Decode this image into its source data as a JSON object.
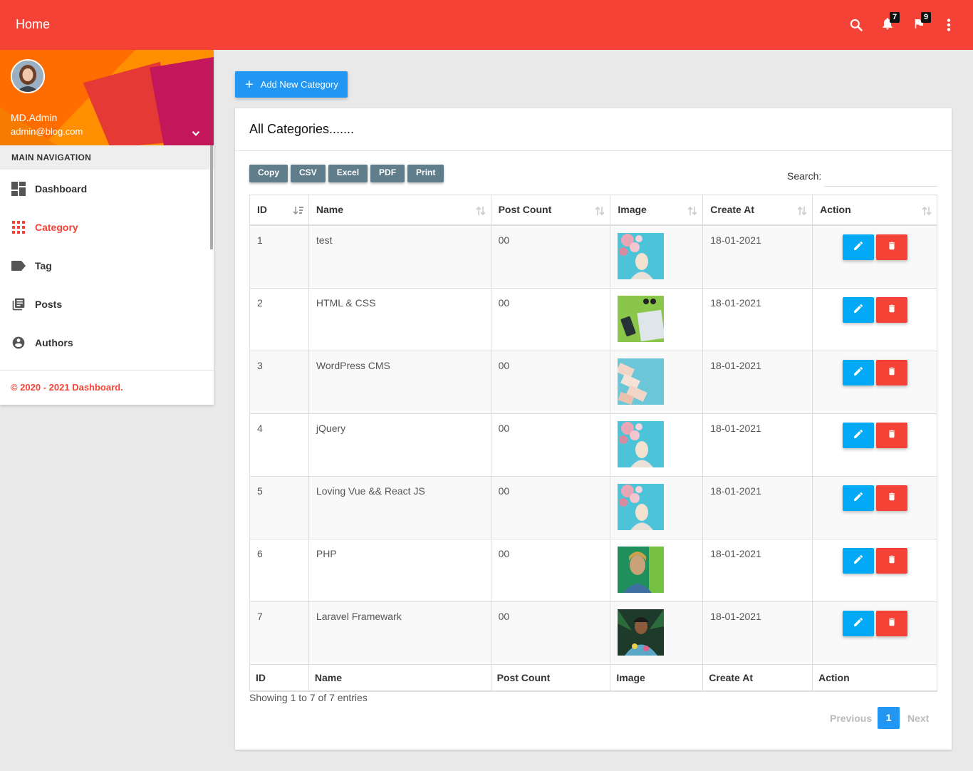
{
  "topbar": {
    "title": "Home",
    "notifications_count": "7",
    "tasks_count": "9",
    "icons": [
      "search-icon",
      "bell-icon",
      "flag-icon",
      "more-vert-icon"
    ],
    "bg_color": "#f44336"
  },
  "sidebar": {
    "user_name": "MD.Admin",
    "user_email": "admin@blog.com",
    "nav_header": "MAIN NAVIGATION",
    "items": [
      {
        "label": "Dashboard",
        "icon": "dashboard-icon",
        "active": false
      },
      {
        "label": "Category",
        "icon": "grid-icon",
        "active": true
      },
      {
        "label": "Tag",
        "icon": "tag-icon",
        "active": false
      },
      {
        "label": "Posts",
        "icon": "posts-icon",
        "active": false
      },
      {
        "label": "Authors",
        "icon": "account-icon",
        "active": false
      }
    ],
    "legal": "© 2020 - 2021 Dashboard."
  },
  "main": {
    "add_button_label": "Add New Category",
    "card_title": "All Categories.......",
    "export_buttons": [
      "Copy",
      "CSV",
      "Excel",
      "PDF",
      "Print"
    ],
    "search_label": "Search:",
    "search_value": "",
    "columns": [
      "ID",
      "Name",
      "Post Count",
      "Image",
      "Create At",
      "Action"
    ],
    "rows": [
      {
        "id": "1",
        "name": "test",
        "post_count": "00",
        "image": "woman-flowers-thumbnail",
        "created": "18-01-2021"
      },
      {
        "id": "2",
        "name": "HTML & CSS",
        "post_count": "00",
        "image": "desk-flatlay-thumbnail",
        "created": "18-01-2021"
      },
      {
        "id": "3",
        "name": "WordPress CMS",
        "post_count": "00",
        "image": "business-cards-thumbnail",
        "created": "18-01-2021"
      },
      {
        "id": "4",
        "name": "jQuery",
        "post_count": "00",
        "image": "woman-flowers-thumbnail",
        "created": "18-01-2021"
      },
      {
        "id": "5",
        "name": "Loving Vue && React JS",
        "post_count": "00",
        "image": "woman-flowers-thumbnail",
        "created": "18-01-2021"
      },
      {
        "id": "6",
        "name": "PHP",
        "post_count": "00",
        "image": "woman-portrait-green-thumbnail",
        "created": "18-01-2021"
      },
      {
        "id": "7",
        "name": "Laravel Framewark",
        "post_count": "00",
        "image": "woman-palm-thumbnail",
        "created": "18-01-2021"
      }
    ],
    "info": "Showing 1 to 7 of 7 entries",
    "pagination": {
      "previous": "Previous",
      "current": "1",
      "next": "Next"
    }
  }
}
